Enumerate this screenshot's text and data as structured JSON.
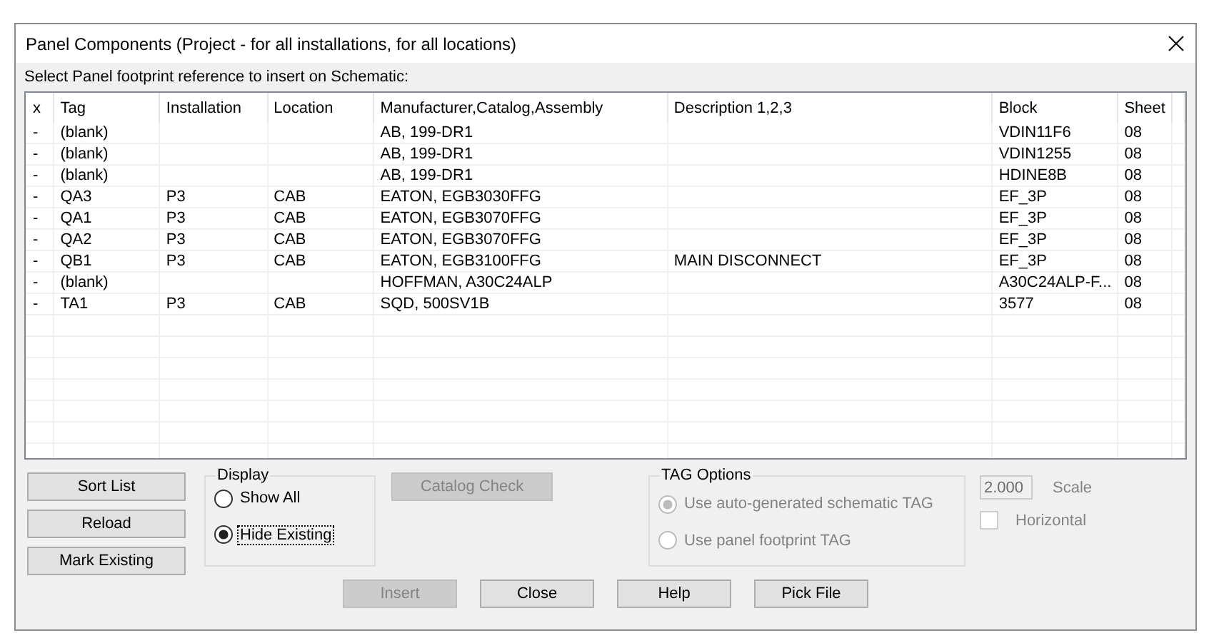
{
  "window": {
    "title": "Panel Components (Project - for all installations, for all locations)"
  },
  "prompt": "Select Panel footprint reference to insert on Schematic:",
  "table": {
    "columns": [
      "x",
      "Tag",
      "Installation",
      "Location",
      "Manufacturer,Catalog,Assembly",
      "Description 1,2,3",
      "Block",
      "Sheet"
    ],
    "rows": [
      [
        "-",
        "(blank)",
        null,
        null,
        "AB, 199-DR1",
        null,
        "VDIN11F6",
        "08"
      ],
      [
        "-",
        "(blank)",
        null,
        null,
        "AB, 199-DR1",
        null,
        "VDIN1255",
        "08"
      ],
      [
        "-",
        "(blank)",
        null,
        null,
        "AB, 199-DR1",
        null,
        "HDINE8B",
        "08"
      ],
      [
        "-",
        "QA3",
        "P3",
        "CAB",
        "EATON, EGB3030FFG",
        null,
        "EF_3P",
        "08"
      ],
      [
        "-",
        "QA1",
        "P3",
        "CAB",
        "EATON, EGB3070FFG",
        null,
        "EF_3P",
        "08"
      ],
      [
        "-",
        "QA2",
        "P3",
        "CAB",
        "EATON, EGB3070FFG",
        null,
        "EF_3P",
        "08"
      ],
      [
        "-",
        "QB1",
        "P3",
        "CAB",
        "EATON, EGB3100FFG",
        "MAIN DISCONNECT",
        "EF_3P",
        "08"
      ],
      [
        "-",
        "(blank)",
        null,
        null,
        "HOFFMAN, A30C24ALP",
        null,
        "A30C24ALP-F...",
        "08"
      ],
      [
        "-",
        "TA1",
        "P3",
        "CAB",
        "SQD, 500SV1B",
        null,
        "3577",
        "08"
      ]
    ]
  },
  "side_buttons": [
    {
      "label": "Sort List",
      "disabled": false
    },
    {
      "label": "Reload",
      "disabled": false
    },
    {
      "label": "Mark Existing",
      "disabled": false
    }
  ],
  "display": {
    "title": "Display",
    "disabled": false,
    "options": [
      {
        "label": "Show All",
        "selected": false,
        "focused": false
      },
      {
        "label": "Hide Existing",
        "selected": true,
        "focused": true
      }
    ]
  },
  "catalog_check": {
    "label": "Catalog Check",
    "disabled": true
  },
  "tag_options": {
    "title": "TAG Options",
    "disabled": true,
    "options": [
      {
        "label": "Use auto-generated schematic TAG",
        "selected": true,
        "focused": false
      },
      {
        "label": "Use panel footprint TAG",
        "selected": false,
        "focused": false
      }
    ]
  },
  "scale": {
    "value": "2.000",
    "label": "Scale",
    "disabled": true
  },
  "horizontal": {
    "label": "Horizontal",
    "checked": false,
    "disabled": true
  },
  "bottom_buttons": [
    {
      "label": "Insert",
      "disabled": true
    },
    {
      "label": "Close",
      "disabled": false
    },
    {
      "label": "Help",
      "disabled": false
    },
    {
      "label": "Pick File",
      "disabled": false
    }
  ]
}
